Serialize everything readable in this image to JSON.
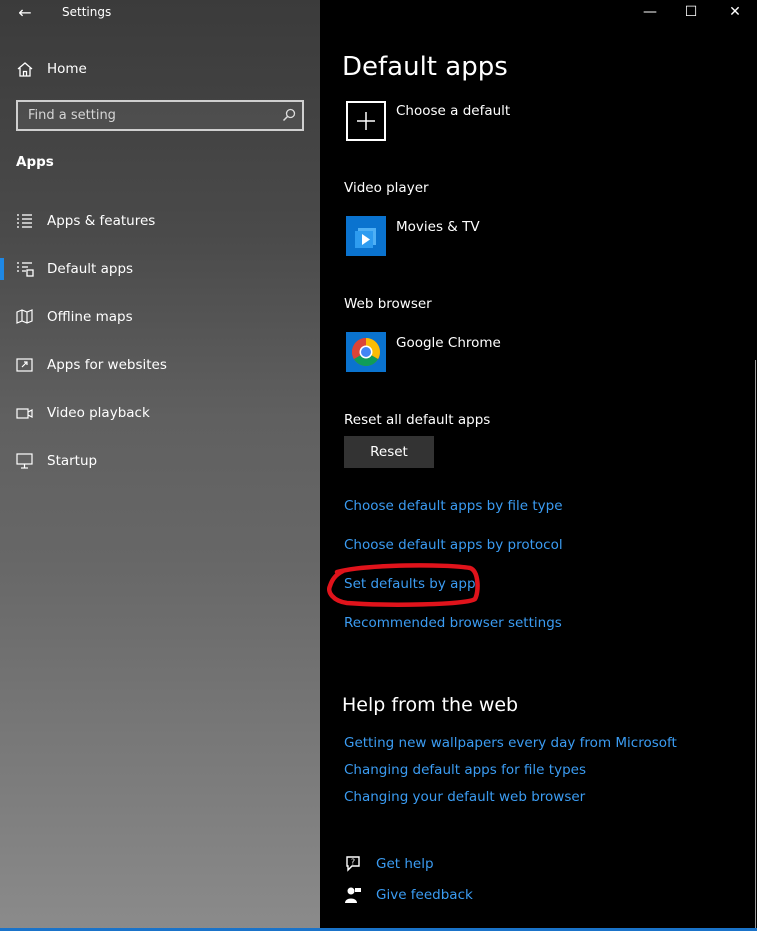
{
  "window": {
    "title": "Settings",
    "back_glyph": "←",
    "minimize_glyph": "—",
    "maximize_glyph": "☐",
    "close_glyph": "✕"
  },
  "sidebar": {
    "home": "Home",
    "search_placeholder": "Find a setting",
    "section": "Apps",
    "items": [
      {
        "label": "Apps & features",
        "icon": "list-icon"
      },
      {
        "label": "Default apps",
        "icon": "default-apps-icon",
        "active": true
      },
      {
        "label": "Offline maps",
        "icon": "map-icon"
      },
      {
        "label": "Apps for websites",
        "icon": "open-in-app-icon"
      },
      {
        "label": "Video playback",
        "icon": "video-icon"
      },
      {
        "label": "Startup",
        "icon": "startup-icon"
      }
    ]
  },
  "main": {
    "title": "Default apps",
    "choose_default": "Choose a default",
    "video_player": {
      "category": "Video player",
      "app": "Movies & TV"
    },
    "web_browser": {
      "category": "Web browser",
      "app": "Google Chrome"
    },
    "reset": {
      "label": "Reset all default apps",
      "button": "Reset"
    },
    "links": [
      "Choose default apps by file type",
      "Choose default apps by protocol",
      "Set defaults by app",
      "Recommended browser settings"
    ],
    "help": {
      "title": "Help from the web",
      "links": [
        "Getting new wallpapers every day from Microsoft",
        "Changing default apps for file types",
        "Changing your default web browser"
      ]
    },
    "footer": {
      "get_help": "Get help",
      "give_feedback": "Give feedback"
    }
  },
  "colors": {
    "accent": "#1e88e5",
    "link": "#3b9cf2",
    "annotation": "#e0131b"
  }
}
